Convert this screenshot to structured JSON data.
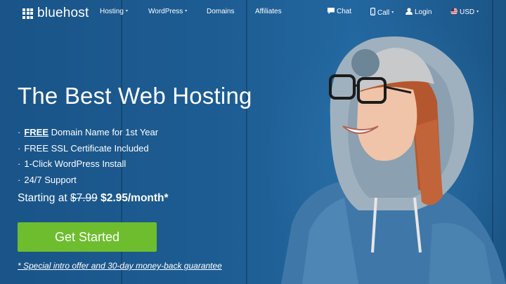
{
  "brand": {
    "name": "bluehost"
  },
  "nav": {
    "links": [
      {
        "label": "Hosting",
        "has_caret": true
      },
      {
        "label": "WordPress",
        "has_caret": true
      },
      {
        "label": "Domains",
        "has_caret": false
      },
      {
        "label": "Affiliates",
        "has_caret": false
      }
    ],
    "chat_label": "Chat",
    "call_label": "Call",
    "login_label": "Login",
    "currency_label": "USD",
    "icons": {
      "chat": "chat-bubble-icon",
      "call": "phone-icon",
      "login": "user-icon",
      "currency": "us-flag-icon"
    }
  },
  "hero": {
    "headline": "The Best Web Hosting",
    "features": [
      {
        "bullet": "·",
        "bold": "FREE",
        "text": " Domain Name for 1st Year"
      },
      {
        "bullet": "·",
        "bold": "",
        "text": "FREE SSL Certificate Included"
      },
      {
        "bullet": "·",
        "bold": "",
        "text": "1-Click WordPress Install"
      },
      {
        "bullet": "·",
        "bold": "",
        "text": "24/7 Support"
      }
    ],
    "pricing": {
      "prefix": "Starting at",
      "old_price": "$7.99",
      "new_price": "$2.95/month*"
    },
    "cta_label": "Get Started",
    "offer_text": "* Special intro offer and 30-day money-back guarantee"
  },
  "colors": {
    "background": "#1d5b8f",
    "cta": "#6ebd2f",
    "text": "#ffffff"
  }
}
